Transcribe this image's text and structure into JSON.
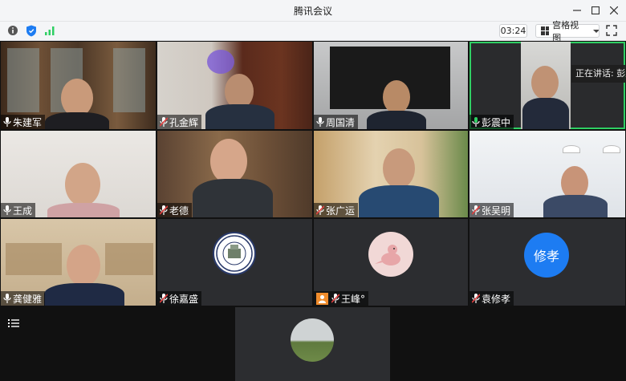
{
  "window": {
    "title": "腾讯会议"
  },
  "toolbar": {
    "timer": "03:24",
    "view_label": "宫格视图"
  },
  "speaking_banner": "正在讲话: 彭震",
  "participants": [
    {
      "name": "朱建军"
    },
    {
      "name": "孔金辉"
    },
    {
      "name": "周国清"
    },
    {
      "name": "彭震中"
    },
    {
      "name": "王成"
    },
    {
      "name": "老德"
    },
    {
      "name": "张广运"
    },
    {
      "name": "张吴明"
    },
    {
      "name": "龚健雅"
    },
    {
      "name": "徐嘉盛"
    },
    {
      "name": "王峰°"
    },
    {
      "name": "袁修孝",
      "avatar_text": "修孝"
    }
  ],
  "colors": {
    "active_border": "#2fcf63",
    "avatar_blue": "#1d7cf2",
    "mic_muted": "#e04040",
    "host_badge": "#f08c2c"
  }
}
